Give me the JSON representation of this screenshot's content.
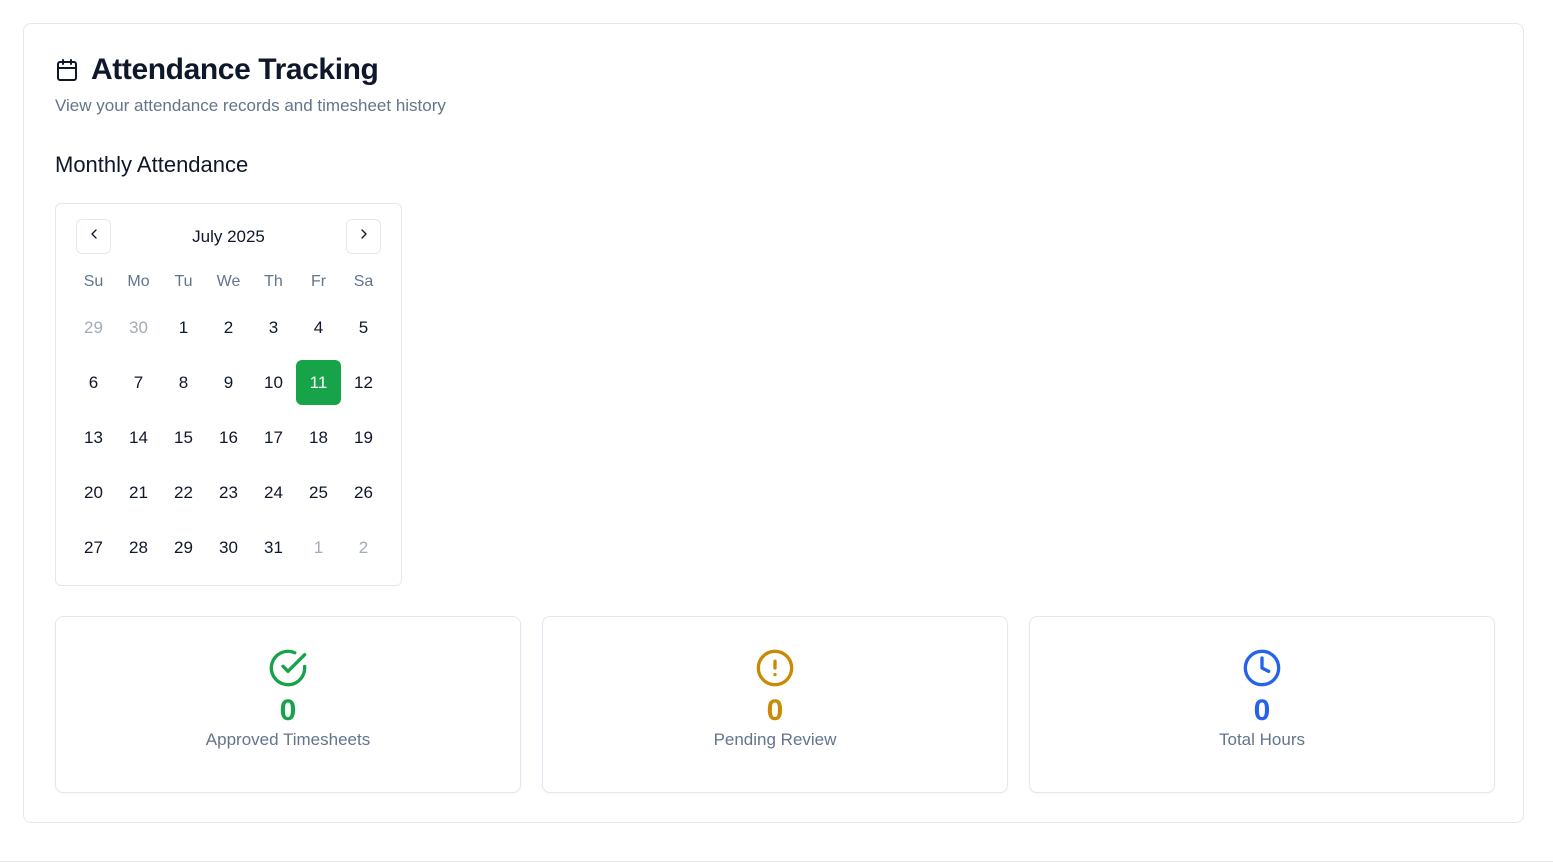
{
  "header": {
    "title": "Attendance Tracking",
    "subtitle": "View your attendance records and timesheet history",
    "icon": "calendar-icon"
  },
  "section": {
    "title": "Monthly Attendance"
  },
  "calendar": {
    "month_label": "July 2025",
    "prev_icon": "chevron-left-icon",
    "next_icon": "chevron-right-icon",
    "weekdays": [
      "Su",
      "Mo",
      "Tu",
      "We",
      "Th",
      "Fr",
      "Sa"
    ],
    "selected_day": "11",
    "weeks": [
      [
        {
          "d": "29",
          "out": true
        },
        {
          "d": "30",
          "out": true
        },
        {
          "d": "1"
        },
        {
          "d": "2"
        },
        {
          "d": "3"
        },
        {
          "d": "4"
        },
        {
          "d": "5"
        }
      ],
      [
        {
          "d": "6"
        },
        {
          "d": "7"
        },
        {
          "d": "8"
        },
        {
          "d": "9"
        },
        {
          "d": "10"
        },
        {
          "d": "11",
          "selected": true
        },
        {
          "d": "12"
        }
      ],
      [
        {
          "d": "13"
        },
        {
          "d": "14"
        },
        {
          "d": "15"
        },
        {
          "d": "16"
        },
        {
          "d": "17"
        },
        {
          "d": "18"
        },
        {
          "d": "19"
        }
      ],
      [
        {
          "d": "20"
        },
        {
          "d": "21"
        },
        {
          "d": "22"
        },
        {
          "d": "23"
        },
        {
          "d": "24"
        },
        {
          "d": "25"
        },
        {
          "d": "26"
        }
      ],
      [
        {
          "d": "27"
        },
        {
          "d": "28"
        },
        {
          "d": "29"
        },
        {
          "d": "30"
        },
        {
          "d": "31"
        },
        {
          "d": "1",
          "out": true
        },
        {
          "d": "2",
          "out": true
        }
      ]
    ],
    "selected_color": "#16a34a"
  },
  "stats": [
    {
      "value": "0",
      "label": "Approved Timesheets",
      "icon": "check-circle-icon",
      "color": "#16a34a"
    },
    {
      "value": "0",
      "label": "Pending Review",
      "icon": "alert-circle-icon",
      "color": "#ca8a04"
    },
    {
      "value": "0",
      "label": "Total Hours",
      "icon": "clock-icon",
      "color": "#2563eb"
    }
  ]
}
